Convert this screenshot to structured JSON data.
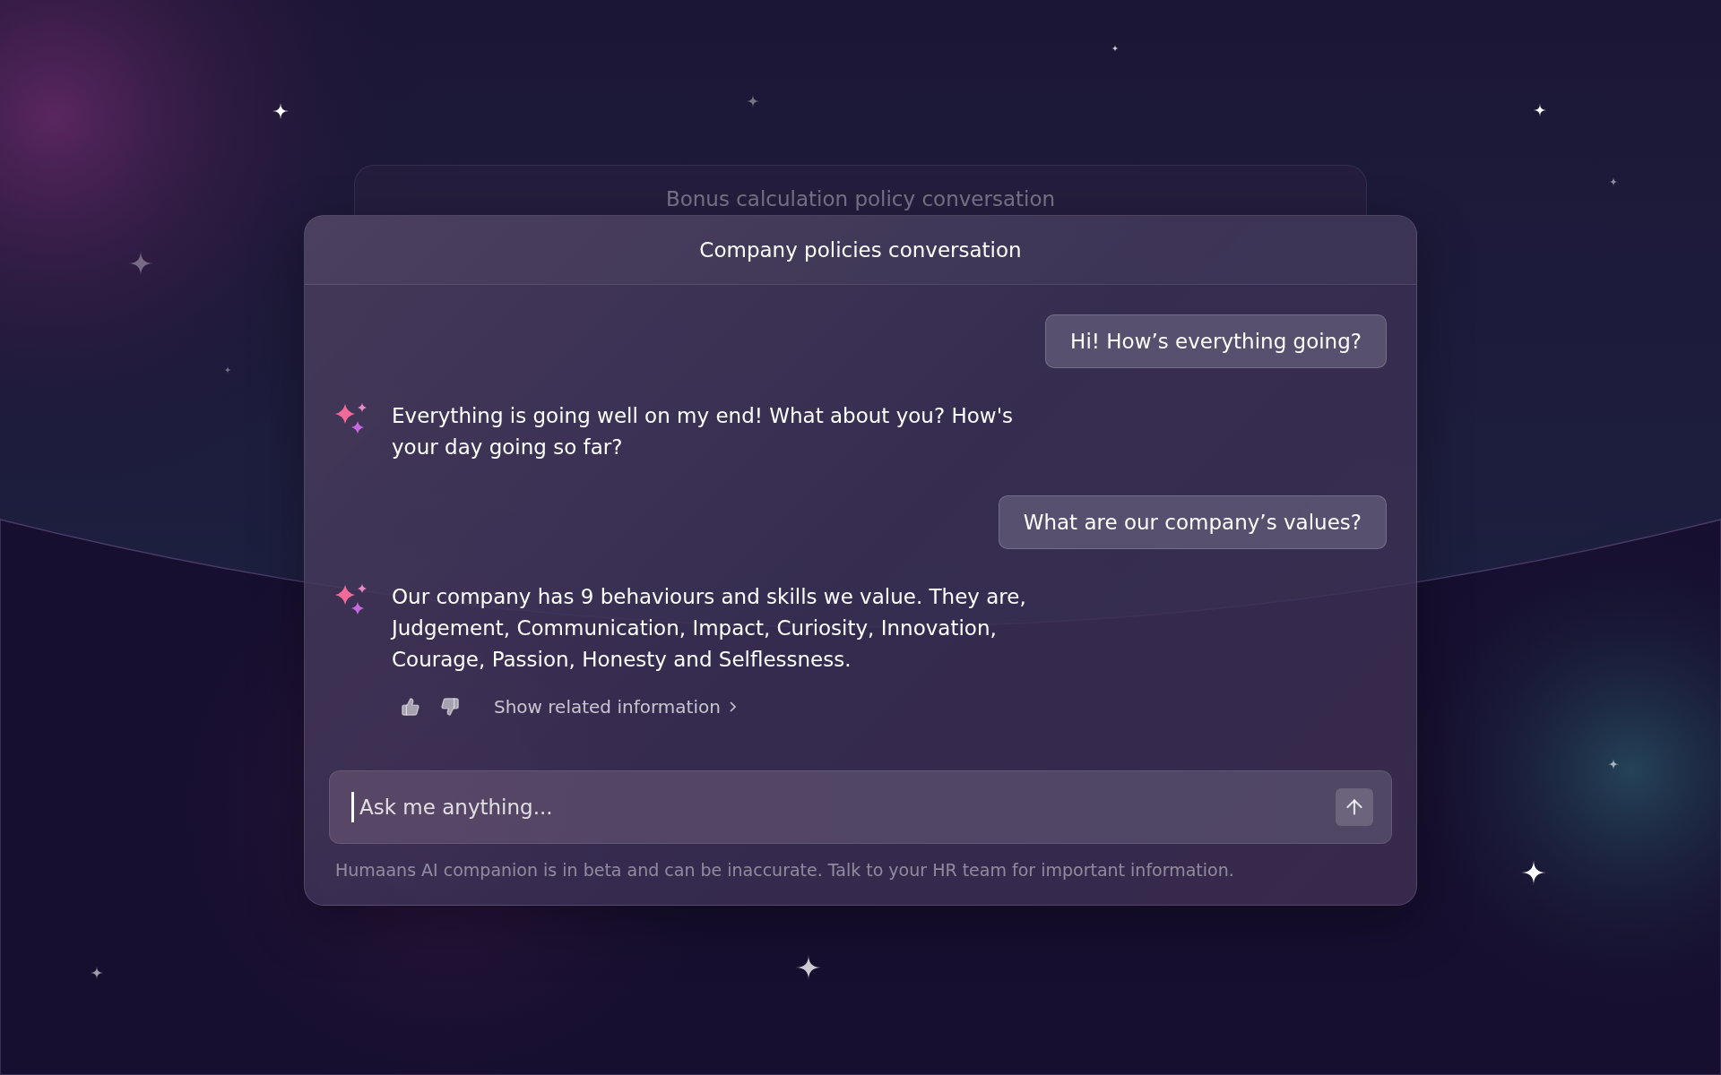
{
  "background_conversation": {
    "title": "Bonus calculation policy conversation"
  },
  "conversation": {
    "title": "Company policies conversation",
    "messages": [
      {
        "kind": "user",
        "text": "Hi! How’s everything going?"
      },
      {
        "kind": "assistant",
        "text": "Everything is going well on my end! What about you? How's your day going so far?"
      },
      {
        "kind": "user",
        "text": "What are our company’s values?"
      },
      {
        "kind": "assistant",
        "text": "Our company has 9 behaviours and skills we value. They are, Judgement, Communication, Impact, Curiosity, Innovation, Courage, Passion, Honesty and Selflessness.",
        "related_link": "Show related information"
      }
    ],
    "input": {
      "placeholder": "Ask me anything..."
    },
    "disclaimer": "Humaans AI companion is in beta and can be inaccurate. Talk to your HR team for important information."
  }
}
